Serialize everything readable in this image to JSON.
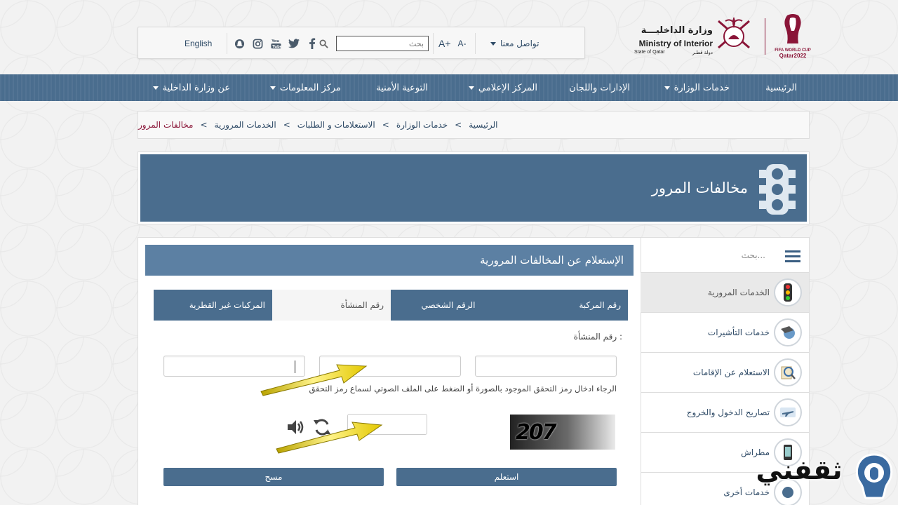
{
  "header": {
    "lang_label": "English",
    "search_placeholder": "بحث",
    "font_decrease": "A-",
    "font_increase": "A+",
    "contact_label": "تواصل معنا",
    "moi_arabic": "وزارة الداخليـــة",
    "moi_english": "Ministry of Interior",
    "moi_state_en": "State of Qatar",
    "moi_state_ar": "دولة قطـر",
    "wc_line1": "FIFA WORLD CUP",
    "wc_line2": "Qatar2022",
    "brand_color": "#8a1538",
    "social_icons": [
      "snapchat-icon",
      "instagram-icon",
      "youtube-icon",
      "twitter-icon",
      "facebook-icon"
    ]
  },
  "nav": {
    "items": [
      {
        "label": "الرئيسية",
        "dropdown": false
      },
      {
        "label": "خدمات الوزارة",
        "dropdown": true
      },
      {
        "label": "الإدارات واللجان",
        "dropdown": false
      },
      {
        "label": "المركز الإعلامي",
        "dropdown": true
      },
      {
        "label": "التوعية الأمنية",
        "dropdown": false
      },
      {
        "label": "مركز المعلومات",
        "dropdown": true
      },
      {
        "label": "عن وزارة الداخلية",
        "dropdown": true
      }
    ]
  },
  "breadcrumb": {
    "items": [
      "الرئيسية",
      "خدمات الوزارة",
      "الاستعلامات و الطلبات",
      "الخدمات المرورية",
      "مخالفات المرور"
    ],
    "separator": ">"
  },
  "banner": {
    "title": "مخالفات المرور",
    "icon": "traffic-light-icon"
  },
  "sidebar": {
    "search_placeholder": "بحث...",
    "items": [
      {
        "label": "الخدمات المرورية",
        "icon": "traffic-light-icon",
        "active": true
      },
      {
        "label": "خدمات التأشيرات",
        "icon": "visa-icon",
        "active": false
      },
      {
        "label": "الاستعلام عن الإقامات",
        "icon": "residency-search-icon",
        "active": false
      },
      {
        "label": "تصاريح الدخول والخروج",
        "icon": "airplane-icon",
        "active": false
      },
      {
        "label": "مطراش",
        "icon": "metrash-phone-icon",
        "active": false
      },
      {
        "label": "خدمات أخرى",
        "icon": "other-services-icon",
        "active": false
      }
    ]
  },
  "form": {
    "title": "الإستعلام عن المخالفات المرورية",
    "tabs": [
      {
        "label": "رقم المركبة",
        "active": false
      },
      {
        "label": "الرقم الشخصي",
        "active": false
      },
      {
        "label": "رقم المنشأة",
        "active": true
      },
      {
        "label": "المركبات غير القطرية",
        "active": false
      }
    ],
    "field_label": "رقم المنشأة :",
    "field_values": [
      "",
      "",
      ""
    ],
    "instruction": "الرجاء ادخال رمز التحقق الموجود بالصورة أو الضغط على الملف الصوتي لسماع رمز التحقق",
    "captcha_code": "207",
    "captcha_value": "",
    "submit_label": "استعلم",
    "clear_label": "مسح"
  },
  "watermark": {
    "text": "ثقفني"
  }
}
